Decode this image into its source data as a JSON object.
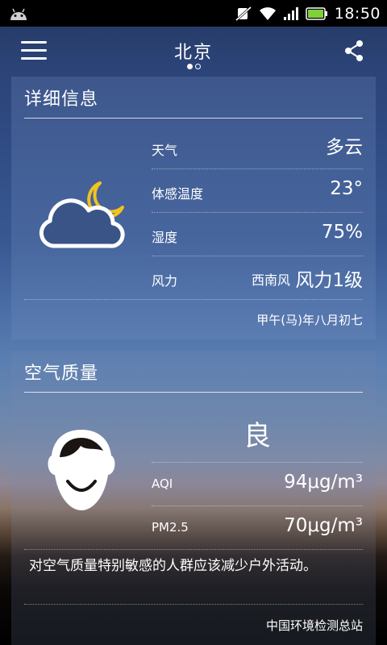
{
  "status_bar": {
    "time": "18:50",
    "icons": [
      "android-icon",
      "mute-icon",
      "wifi-icon",
      "signal-icon",
      "battery-icon"
    ]
  },
  "header": {
    "city": "北京",
    "page_dots": 2,
    "active_dot": 0,
    "icons": [
      "menu-icon",
      "share-icon"
    ]
  },
  "detail": {
    "title": "详细信息",
    "icon": "partly-cloudy-night-icon",
    "weather_label": "天气",
    "weather_value": "多云",
    "feels_label": "体感温度",
    "feels_value": "23°",
    "humidity_label": "湿度",
    "humidity_value": "75%",
    "wind_label": "风力",
    "wind_direction": "西南风",
    "wind_value": "风力1级",
    "lunar_date": "甲午(马)年八月初七"
  },
  "air": {
    "title": "空气质量",
    "icon": "smiling-face-icon",
    "grade": "良",
    "aqi_label": "AQI",
    "aqi_value": "94μg/m³",
    "pm_label": "PM2.5",
    "pm_value": "70μg/m³",
    "advice": "对空气质量特别敏感的人群应该减少户外活动。",
    "source": "中国环境检测总站"
  }
}
